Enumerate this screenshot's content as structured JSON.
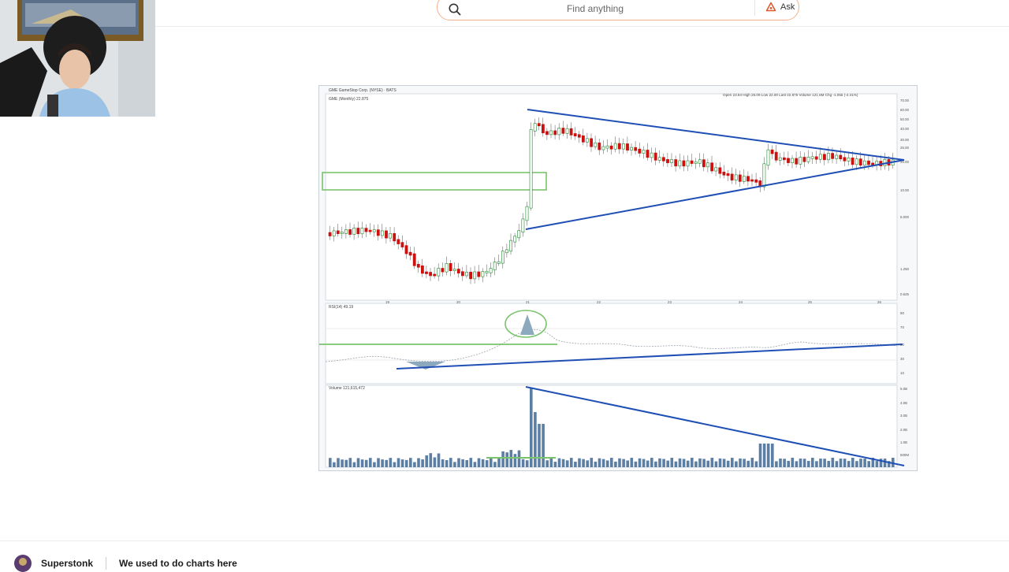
{
  "search": {
    "placeholder": "Find anything",
    "ask_label": "Ask"
  },
  "chart": {
    "header_left_1": "GME GameStop Corp. (NYSE) · BATS",
    "header_left_2": "GME (Monthly) 22.875",
    "header_right": "Open 23.84  High 26.09  Low 22.00  Last 22.875  Volume 121.6M  Chg -1.055 (-4.41%)",
    "rsi_label": "RSI(14) 49.19",
    "volume_label": "Volume 121,615,472",
    "price_axis": [
      "70.00",
      "60.00",
      "50.00",
      "40.00",
      "30.00",
      "25.00",
      "20.00",
      "10.00",
      "5.000",
      "1.250",
      "0.625"
    ],
    "rsi_axis": [
      "90",
      "70",
      "50",
      "30",
      "10"
    ],
    "volume_axis": [
      "5.0B",
      "4.0B",
      "3.0B",
      "2.0B",
      "1.0B",
      "500M"
    ],
    "year_labels": [
      "19",
      "20",
      "21",
      "22",
      "23",
      "24",
      "25",
      "26"
    ]
  },
  "footer": {
    "community": "Superstonk",
    "post_title": "We used to do charts here"
  },
  "colors": {
    "up": "#1f8a2e",
    "down": "#cc1111",
    "trendline": "#1f4fb5",
    "highlight": "#7ac46c",
    "volume": "#5b7ea4",
    "search_border": "#f2b38c"
  }
}
